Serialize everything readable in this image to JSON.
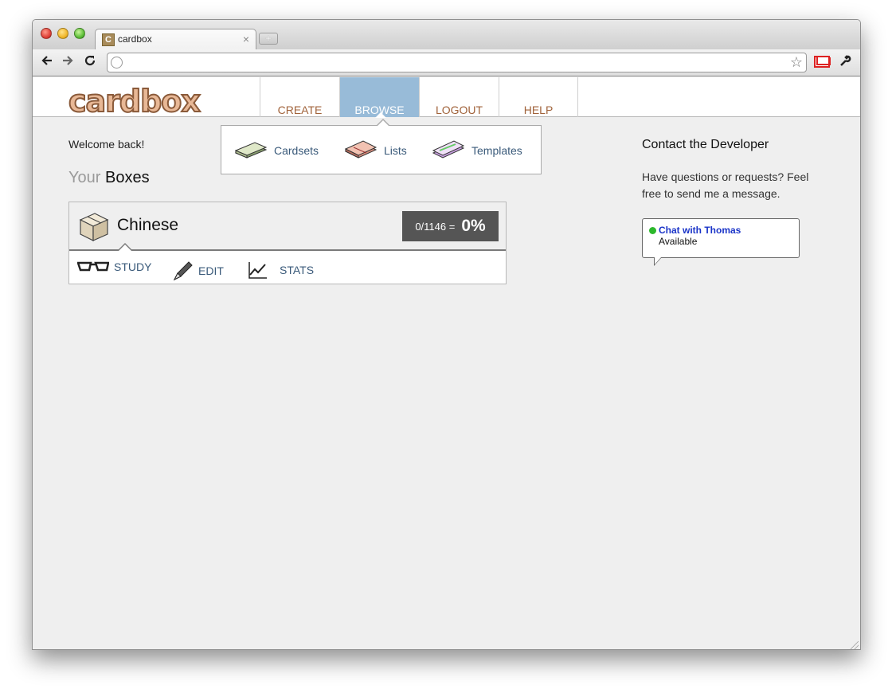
{
  "browser": {
    "tab_title": "cardbox",
    "tab_favicon_letter": "C",
    "new_tab_symbol": "+",
    "close_symbol": "×"
  },
  "site": {
    "logo": "cardbox",
    "nav": [
      {
        "label": "CREATE",
        "active": false
      },
      {
        "label": "BROWSE",
        "active": true
      },
      {
        "label": "LOGOUT",
        "active": false
      },
      {
        "label": "HELP",
        "active": false
      }
    ],
    "dropdown": [
      {
        "label": "Cardsets",
        "icon": "cardsets-icon"
      },
      {
        "label": "Lists",
        "icon": "lists-icon"
      },
      {
        "label": "Templates",
        "icon": "templates-icon"
      }
    ]
  },
  "main": {
    "welcome": "Welcome back!",
    "heading_prefix": "Your",
    "heading_main": "Boxes",
    "box": {
      "name": "Chinese",
      "fraction": "0/1146 =",
      "percent": "0%",
      "actions": [
        {
          "label": "STUDY",
          "icon": "glasses-icon"
        },
        {
          "label": "EDIT",
          "icon": "pencil-icon"
        },
        {
          "label": "STATS",
          "icon": "chart-icon"
        }
      ]
    }
  },
  "sidebar": {
    "title": "Contact the Developer",
    "text": "Have questions or requests? Feel free to send me a message.",
    "chat_name": "Chat with Thomas",
    "chat_status": "Available"
  },
  "colors": {
    "nav_active_bg": "#98bbd8",
    "nav_text": "#a0623a",
    "link": "#3a5a7a",
    "chat_link": "#1a34c8",
    "status_green": "#2cb82c"
  }
}
